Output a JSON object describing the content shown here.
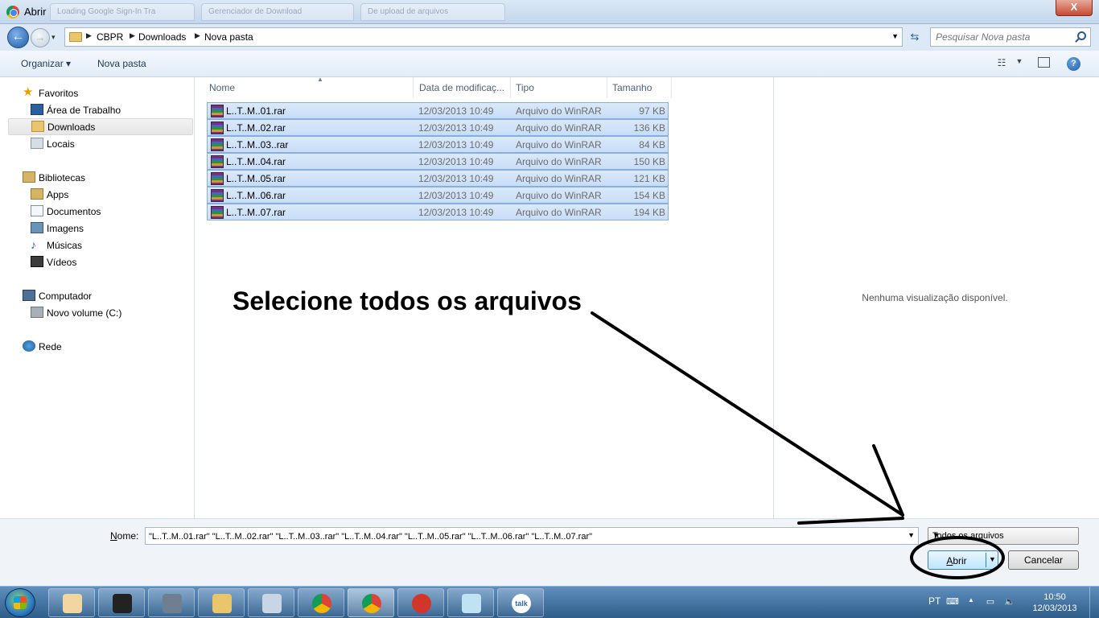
{
  "window": {
    "title": "Abrir",
    "close_label": "X"
  },
  "ghost_tabs": [
    "Loading Google Sign-In Tra",
    "Gerenciador de Download",
    "De upload de arquivos"
  ],
  "navbar": {
    "back_label": "←",
    "forward_label": "→",
    "recent_label": "▾",
    "breadcrumbs": [
      "CBPR",
      "Downloads",
      "Nova pasta"
    ],
    "search_placeholder": "Pesquisar Nova pasta"
  },
  "toolbar": {
    "organize": "Organizar ▾",
    "new_folder": "Nova pasta",
    "help": "?"
  },
  "sidebar": {
    "favorites": {
      "label": "Favoritos",
      "items": [
        "Área de Trabalho",
        "Downloads",
        "Locais"
      ]
    },
    "libraries": {
      "label": "Bibliotecas",
      "items": [
        "Apps",
        "Documentos",
        "Imagens",
        "Músicas",
        "Vídeos"
      ]
    },
    "computer": {
      "label": "Computador",
      "items": [
        "Novo volume (C:)"
      ]
    },
    "network": {
      "label": "Rede"
    }
  },
  "columns": {
    "name": "Nome",
    "date": "Data de modificaç...",
    "type": "Tipo",
    "size": "Tamanho"
  },
  "files": [
    {
      "name": "L..T..M..01.rar",
      "date": "12/03/2013 10:49",
      "type": "Arquivo do WinRAR",
      "size": "97 KB"
    },
    {
      "name": "L..T..M..02.rar",
      "date": "12/03/2013 10:49",
      "type": "Arquivo do WinRAR",
      "size": "136 KB"
    },
    {
      "name": "L..T..M..03..rar",
      "date": "12/03/2013 10:49",
      "type": "Arquivo do WinRAR",
      "size": "84 KB"
    },
    {
      "name": "L..T..M..04.rar",
      "date": "12/03/2013 10:49",
      "type": "Arquivo do WinRAR",
      "size": "150 KB"
    },
    {
      "name": "L..T..M..05.rar",
      "date": "12/03/2013 10:49",
      "type": "Arquivo do WinRAR",
      "size": "121 KB"
    },
    {
      "name": "L..T..M..06.rar",
      "date": "12/03/2013 10:49",
      "type": "Arquivo do WinRAR",
      "size": "154 KB"
    },
    {
      "name": "L..T..M..07.rar",
      "date": "12/03/2013 10:49",
      "type": "Arquivo do WinRAR",
      "size": "194 KB"
    }
  ],
  "preview": {
    "message": "Nenhuma visualização disponível."
  },
  "annotation": {
    "text": "Selecione todos os arquivos"
  },
  "bottom": {
    "name_label_accel": "N",
    "name_label_rest": "ome:",
    "name_value": "\"L..T..M..01.rar\" \"L..T..M..02.rar\" \"L..T..M..03..rar\" \"L..T..M..04.rar\" \"L..T..M..05.rar\" \"L..T..M..06.rar\" \"L..T..M..07.rar\"",
    "file_type": "Todos os arquivos",
    "open_accel": "A",
    "open_rest": "brir",
    "cancel": "Cancelar"
  },
  "taskbar": {
    "apps": [
      "paint-app",
      "media-player-321",
      "scanner-app",
      "file-explorer",
      "calculator",
      "chrome",
      "chrome-active",
      "ccleaner",
      "notepad-app",
      "google-talk"
    ],
    "language": "PT",
    "time": "10:50",
    "date": "12/03/2013"
  },
  "colors": {
    "selection": "#c7ddf7",
    "selection_border": "#87aee0",
    "taskbar": "#2f5d8a",
    "titlebar": "#c3d6ec"
  }
}
